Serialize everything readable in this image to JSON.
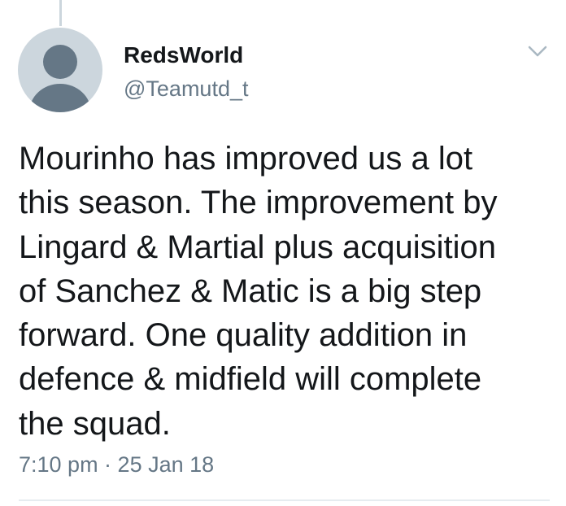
{
  "tweet": {
    "author": {
      "display_name": "RedsWorld",
      "handle": "@Teamutd_t",
      "avatar_icon": "default-profile-icon"
    },
    "menu_icon": "chevron-down-icon",
    "text": "Mourinho has improved us a lot\nthis season. The improvement by\nLingard & Martial plus acquisition\nof Sanchez & Matic is a big step\nforward. One quality addition in\ndefence & midfield will complete\nthe squad.",
    "timestamp": "7:10 pm · 25 Jan 18"
  },
  "colors": {
    "primary_text": "#14171a",
    "secondary_text": "#657786",
    "avatar_bg": "#ccd6dd",
    "avatar_fg": "#657786",
    "divider": "#e6ecf0"
  }
}
